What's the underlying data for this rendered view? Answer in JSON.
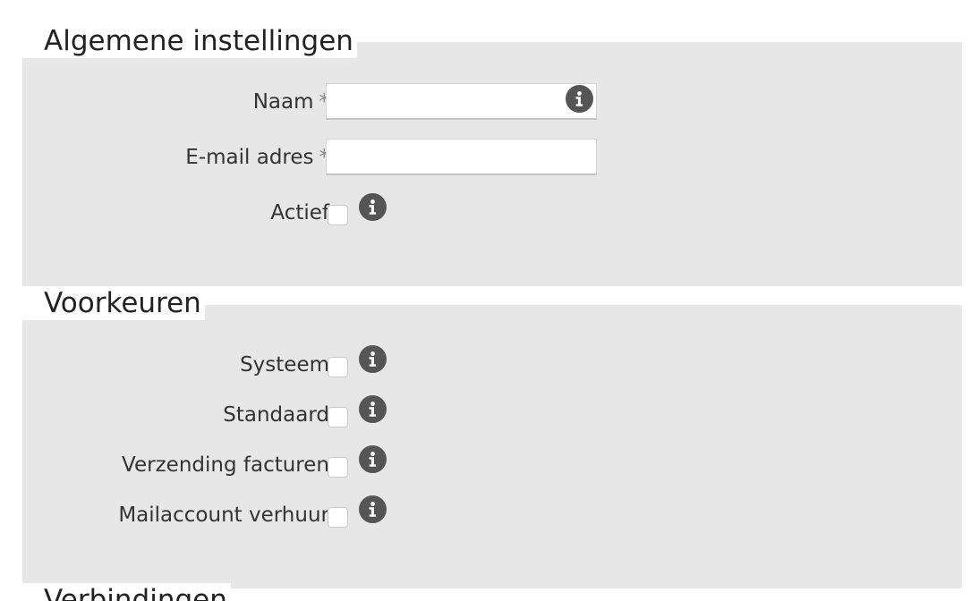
{
  "sections": [
    {
      "title": "Algemene instellingen",
      "fields": [
        {
          "label": "Naam",
          "required_mark": "*",
          "type": "text",
          "value": "",
          "placeholder": "",
          "info_icon": "info-icon"
        },
        {
          "label": "E-mail adres",
          "required_mark": "*",
          "type": "text",
          "value": "",
          "placeholder": ""
        },
        {
          "label": "Actief",
          "type": "checkbox",
          "checked": false,
          "info_icon": "info-icon"
        }
      ]
    },
    {
      "title": "Voorkeuren",
      "fields": [
        {
          "label": "Systeem",
          "type": "checkbox",
          "checked": false,
          "info_icon": "info-icon"
        },
        {
          "label": "Standaard",
          "type": "checkbox",
          "checked": false,
          "info_icon": "info-icon"
        },
        {
          "label": "Verzending facturen",
          "type": "checkbox",
          "checked": false,
          "info_icon": "info-icon"
        },
        {
          "label": "Mailaccount verhuur",
          "type": "checkbox",
          "checked": false,
          "info_icon": "info-icon"
        }
      ]
    },
    {
      "title": "Verbindingen"
    }
  ],
  "colors": {
    "panel_background": "#e7e7e7",
    "info_icon": "#555555",
    "required_mark": "#888888"
  }
}
